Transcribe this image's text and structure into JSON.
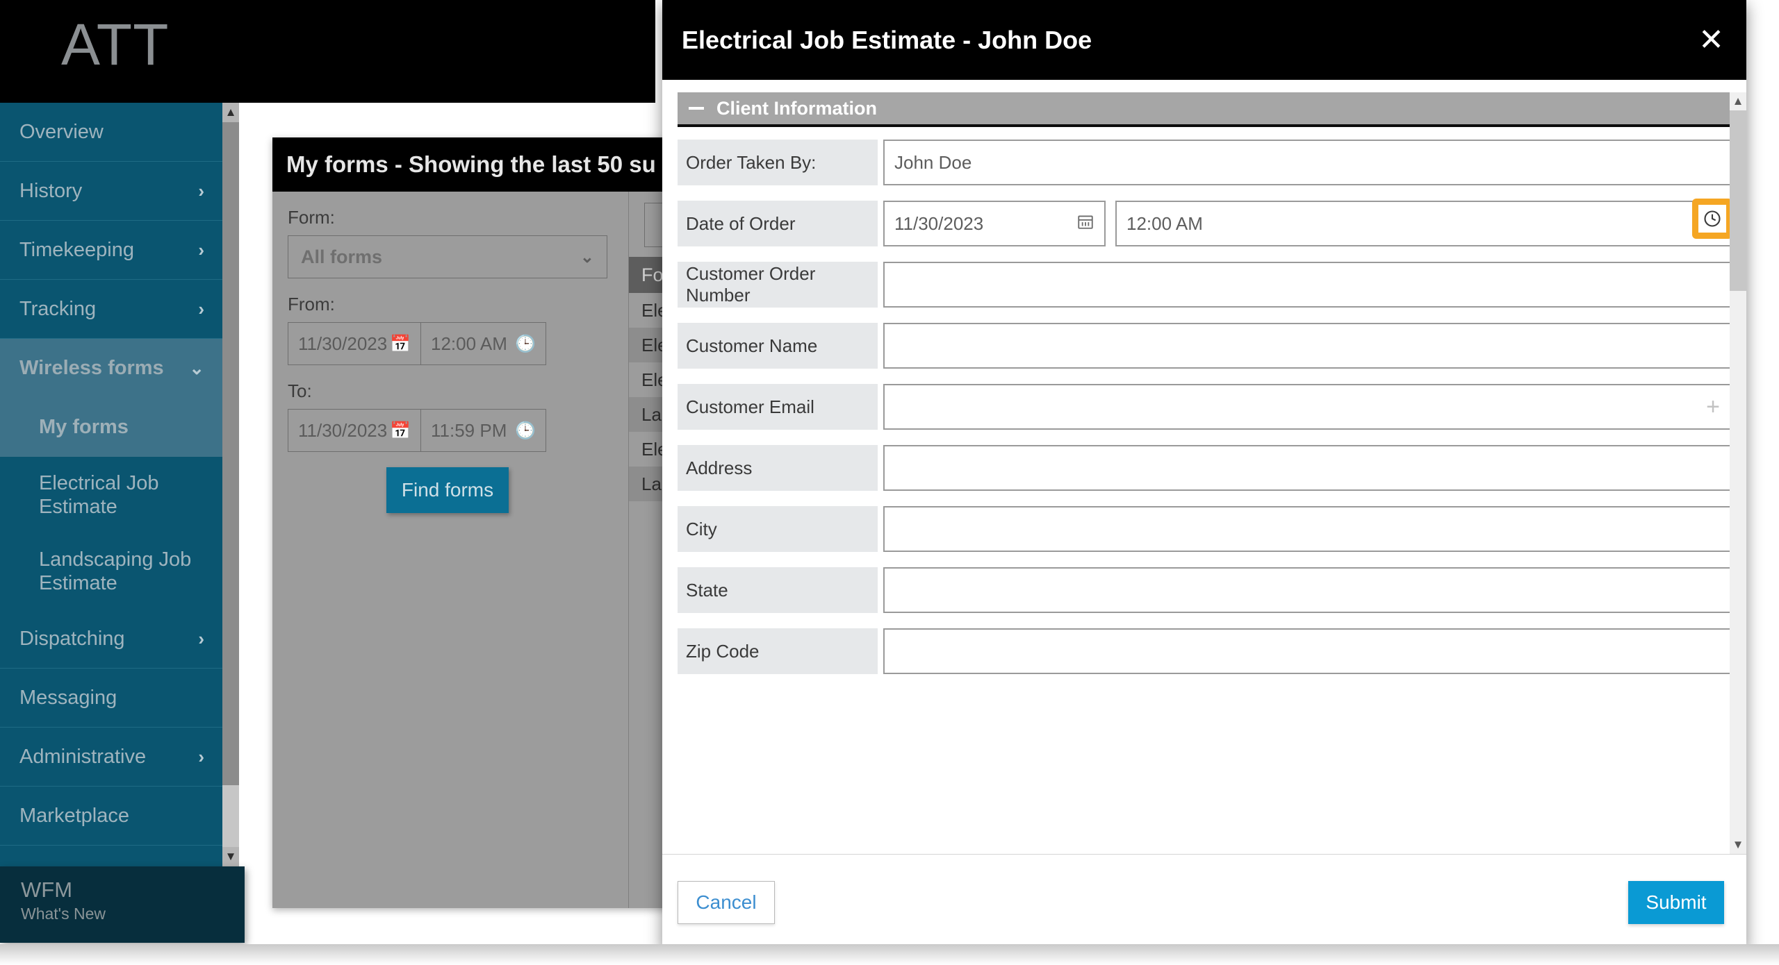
{
  "brand": {
    "logo_text": "ATT"
  },
  "sidebar": {
    "items": [
      {
        "label": "Overview",
        "icon": "",
        "expandable": false
      },
      {
        "label": "History",
        "icon": "chevron-right-icon",
        "expandable": true
      },
      {
        "label": "Timekeeping",
        "icon": "chevron-right-icon",
        "expandable": true
      },
      {
        "label": "Tracking",
        "icon": "chevron-right-icon",
        "expandable": true
      },
      {
        "label": "Wireless forms",
        "icon": "chevron-down-icon",
        "expandable": true,
        "active": true
      },
      {
        "label": "Dispatching",
        "icon": "chevron-right-icon",
        "expandable": true
      },
      {
        "label": "Messaging",
        "icon": "",
        "expandable": false
      },
      {
        "label": "Administrative",
        "icon": "chevron-right-icon",
        "expandable": true
      },
      {
        "label": "Marketplace",
        "icon": "",
        "expandable": false
      }
    ],
    "sub_items": [
      {
        "label": "My forms",
        "current": true
      },
      {
        "label": "Electrical Job Estimate",
        "current": false
      },
      {
        "label": "Landscaping Job Estimate",
        "current": false
      }
    ],
    "scroll_up_icon": "chevron-up-icon",
    "scroll_down_icon": "chevron-down-icon"
  },
  "wfm_panel": {
    "title": "WFM",
    "subtitle": "What's New"
  },
  "main_panel": {
    "header": "My forms - Showing the last 50 su",
    "filters": {
      "form_label": "Form:",
      "form_value": "All forms",
      "form_caret_icon": "chevron-down-icon",
      "from_label": "From:",
      "from_date": "11/30/2023",
      "from_time": "12:00 AM",
      "to_label": "To:",
      "to_date": "11/30/2023",
      "to_time": "11:59 PM",
      "find_button": "Find forms",
      "calendar_icon": "calendar-icon",
      "clock_icon": "clock-icon"
    },
    "search_icon": "search-icon",
    "table": {
      "header": "For",
      "rows": [
        "Elec",
        "Elec",
        "Elec",
        "Land",
        "Elec",
        "Land"
      ]
    }
  },
  "modal": {
    "title": "Electrical Job Estimate - John Doe",
    "close_icon": "close-icon",
    "section": {
      "label": "Client Information",
      "collapse_icon": "minus-icon"
    },
    "fields": [
      {
        "label": "Order Taken By:",
        "value": "John Doe",
        "type": "text"
      },
      {
        "label": "Date of Order",
        "type": "datetime",
        "date_value": "11/30/2023",
        "time_value": "12:00 AM",
        "calendar_icon": "calendar-icon",
        "clock_icon": "clock-icon",
        "clock_highlighted": true
      },
      {
        "label": "Customer Order Number",
        "value": "",
        "type": "text"
      },
      {
        "label": "Customer Name",
        "value": "",
        "type": "text"
      },
      {
        "label": "Customer Email",
        "value": "",
        "type": "text",
        "trailing_icon": "plus-icon"
      },
      {
        "label": "Address",
        "value": "",
        "type": "text"
      },
      {
        "label": "City",
        "value": "",
        "type": "text"
      },
      {
        "label": "State",
        "value": "",
        "type": "text"
      },
      {
        "label": "Zip Code",
        "value": "",
        "type": "text"
      }
    ],
    "footer": {
      "cancel_label": "Cancel",
      "submit_label": "Submit"
    },
    "scroll_up_icon": "chevron-up-icon",
    "scroll_down_icon": "chevron-down-icon"
  },
  "colors": {
    "sidebar_blue": "#0a5570",
    "sidebar_active": "#3d7289",
    "wfm_dark": "#072e3d",
    "highlight_orange": "#f5a623",
    "submit_blue": "#0a9ad4",
    "cancel_text_blue": "#3c8ed0",
    "find_button_blue": "#0b6f94"
  }
}
